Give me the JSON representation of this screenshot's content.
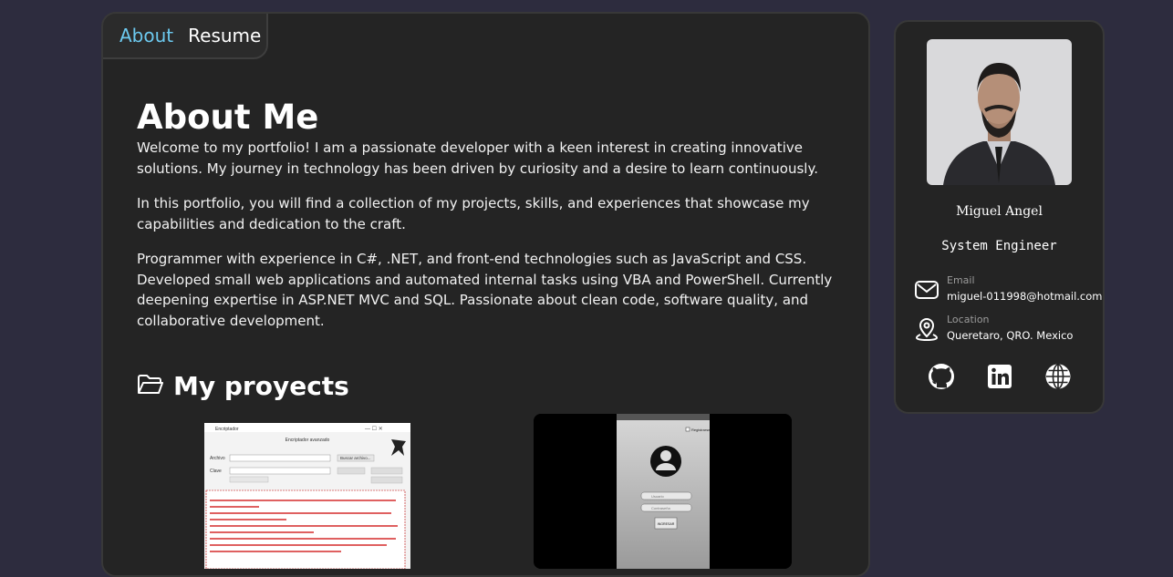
{
  "nav": {
    "tabs": [
      {
        "label": "About",
        "active": true
      },
      {
        "label": "Resume",
        "active": false
      }
    ]
  },
  "about": {
    "title": "About Me",
    "paragraphs": [
      "Welcome to my portfolio! I am a passionate developer with a keen interest in creating innovative solutions. My journey in technology has been driven by curiosity and a desire to learn continuously.",
      "In this portfolio, you will find a collection of my projects, skills, and experiences that showcase my capabilities and dedication to the craft.",
      "Programmer with experience in C#, .NET, and front-end technologies such as JavaScript and CSS. Developed small web applications and automated internal tasks using VBA and PowerShell. Currently deepening expertise in ASP.NET MVC and SQL. Passionate about clean code, software quality, and collaborative development."
    ]
  },
  "projects": {
    "title": "My proyects",
    "icon": "folder-open-icon",
    "items": [
      {
        "name": "encryptor-app-screenshot",
        "window_title": "Encriptador",
        "heading": "Encriptador avanzado",
        "file_label": "Archivo",
        "key_label": "Clave",
        "browse_label": "Buscar archivo...",
        "encrypt_label": "Encriptar",
        "decrypt_label": "Desencriptar"
      },
      {
        "name": "mobile-login-app-screenshot",
        "remember_label": "Registrarse",
        "user_placeholder": "Usuario",
        "password_placeholder": "Contraseña",
        "login_label": "INGRESAR"
      }
    ]
  },
  "profile": {
    "name": "Miguel Angel",
    "role": "System Engineer",
    "email_label": "Email",
    "email": "miguel-011998@hotmail.com",
    "location_label": "Location",
    "location": "Queretaro, QRO. Mexico",
    "social": [
      "github-icon",
      "linkedin-icon",
      "globe-icon"
    ]
  },
  "colors": {
    "background": "#2d2c3e",
    "card": "#242424",
    "accent": "#6cc9ef"
  }
}
